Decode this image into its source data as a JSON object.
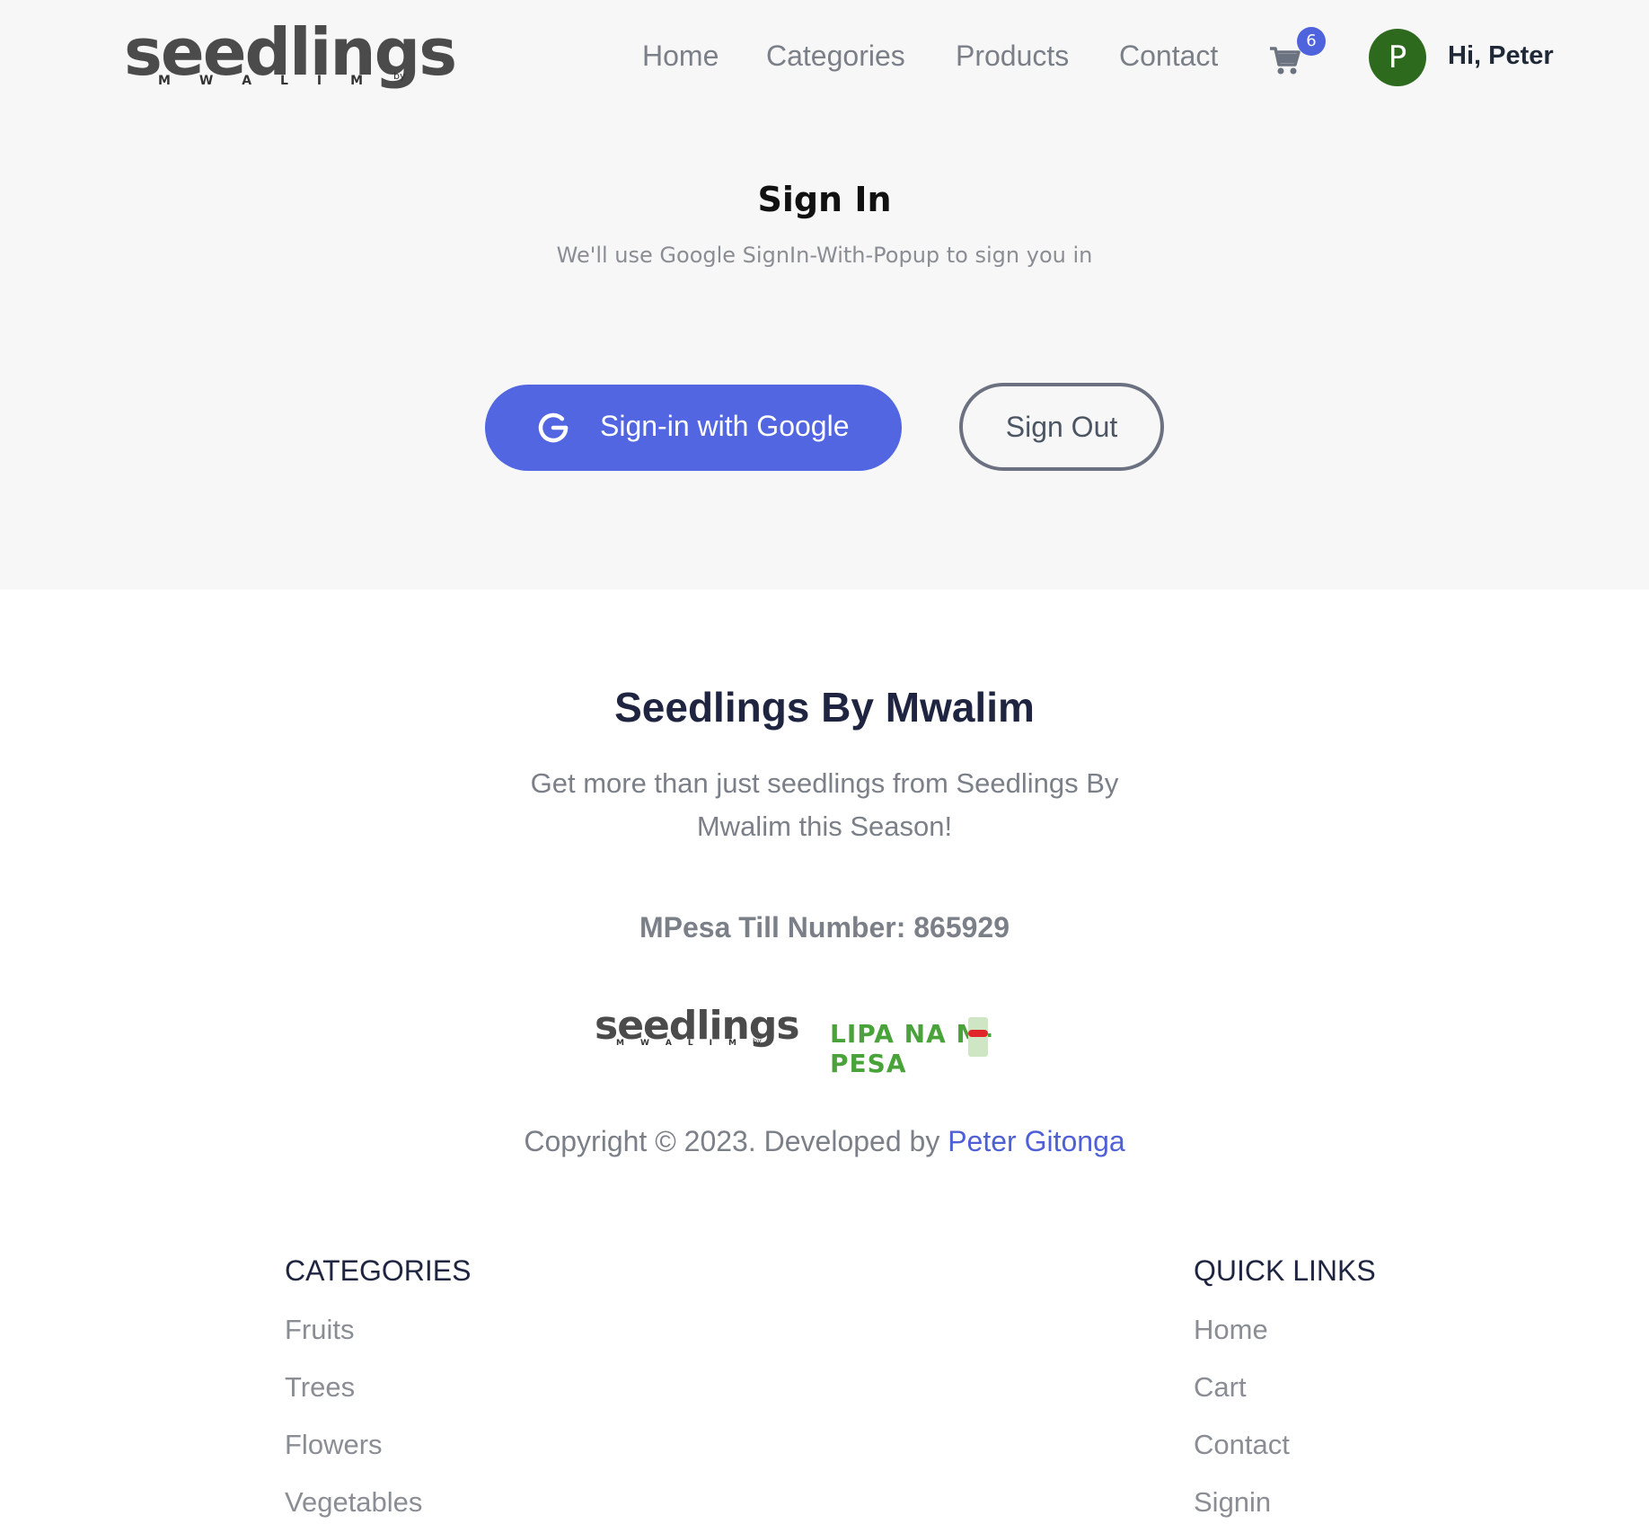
{
  "header": {
    "logo": {
      "word": "seedlings",
      "sub_letters": [
        "M",
        "W",
        "A",
        "L",
        "I",
        "M"
      ],
      "by": "by"
    },
    "nav": [
      {
        "label": "Home"
      },
      {
        "label": "Categories"
      },
      {
        "label": "Products"
      },
      {
        "label": "Contact"
      }
    ],
    "cart": {
      "icon": "cart-icon",
      "count": "6"
    },
    "user": {
      "avatar_letter": "P",
      "greeting": "Hi, Peter"
    }
  },
  "signin": {
    "title": "Sign In",
    "subtitle": "We'll use Google SignIn-With-Popup to sign you in",
    "google_button": "Sign-in with Google",
    "signout_button": "Sign Out"
  },
  "footer": {
    "title": "Seedlings By Mwalim",
    "tagline": "Get more than just seedlings from Seedlings By Mwalim this Season!",
    "till": "MPesa Till Number: 865929",
    "mpesa_logo": "LIPA NA M-PESA",
    "copyright_prefix": "Copyright © 2023. Developed by ",
    "developer": "Peter Gitonga",
    "categories": {
      "title": "CATEGORIES",
      "items": [
        "Fruits",
        "Trees",
        "Flowers",
        "Vegetables"
      ]
    },
    "quick_links": {
      "title": "QUICK LINKS",
      "items": [
        "Home",
        "Cart",
        "Contact",
        "Signin"
      ]
    }
  },
  "colors": {
    "accent": "#5166e0",
    "avatar": "#2e6a1e",
    "mpesa_green": "#4aa23a",
    "link": "#4f5fd6"
  }
}
